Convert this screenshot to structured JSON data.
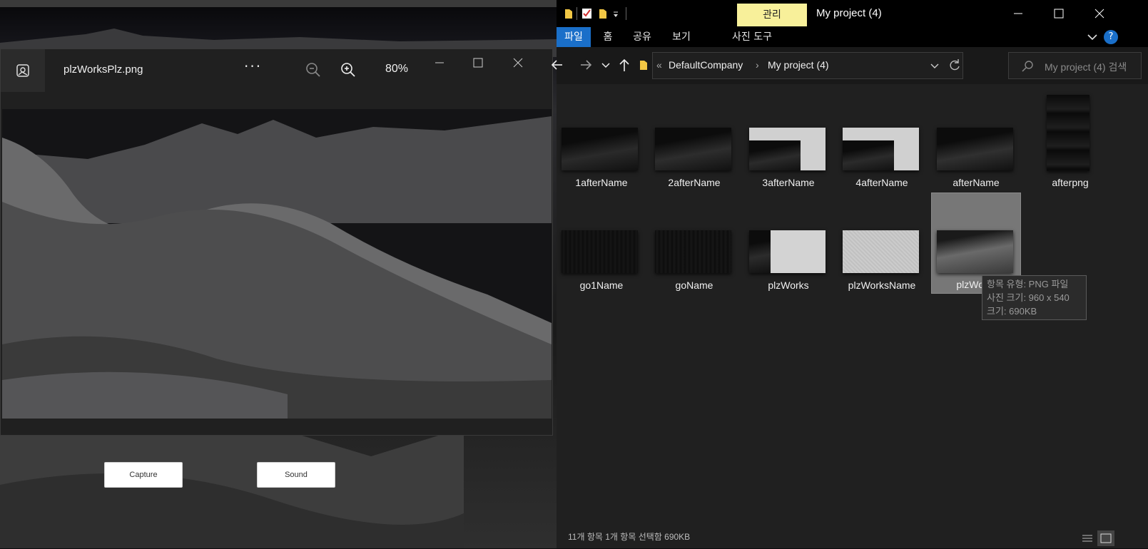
{
  "background": {
    "capture_label": "Capture",
    "sound_label": "Sound"
  },
  "viewer": {
    "title": "plzWorksPlz.png",
    "more": "···",
    "zoom": "80%"
  },
  "explorer": {
    "manage_tab": "관리",
    "title": "My project (4)",
    "tabs": [
      "파일",
      "홈",
      "공유",
      "보기",
      "사진 도구"
    ],
    "breadcrumb": {
      "overflow": "«",
      "parent": "DefaultCompany",
      "separator": "›",
      "current": "My project (4)"
    },
    "search_placeholder": "My project (4) 검색",
    "files": [
      "1afterName",
      "2afterName",
      "3afterName",
      "4afterName",
      "afterName",
      "afterpng",
      "go1Name",
      "goName",
      "plzWorks",
      "plzWorksName",
      "plzWorksPlz"
    ],
    "selected_label": "plzWorks",
    "tooltip": {
      "type": "항목 유형: PNG 파일",
      "size": "사진 크기: 960 x 540",
      "bytes": "크기: 690KB"
    },
    "status": "11개 항목   1개 항목 선택함 690KB"
  },
  "colors": {
    "accent": "#1a6fc9",
    "manage_tab": "#f8f09a",
    "selected": "#777777"
  }
}
